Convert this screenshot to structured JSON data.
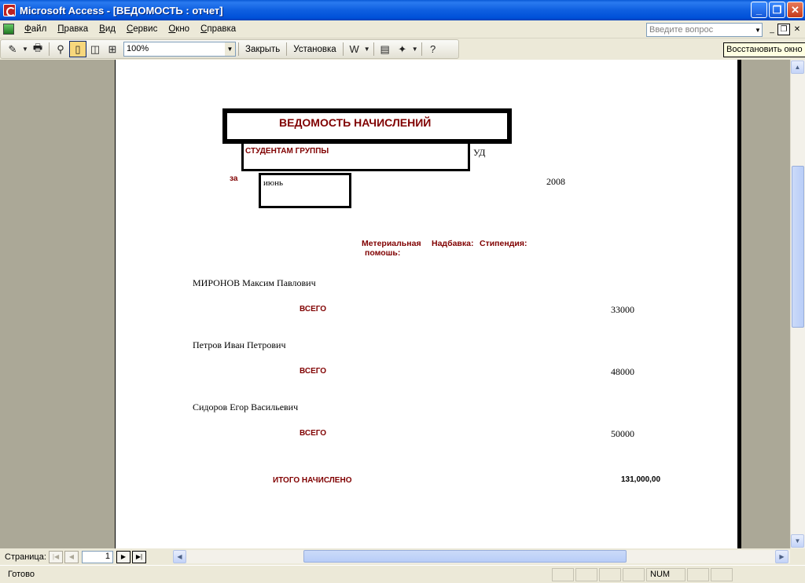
{
  "window": {
    "title": "Microsoft Access - [ВЕДОМОСТЬ : отчет]"
  },
  "menu": {
    "items": [
      "Файл",
      "Правка",
      "Вид",
      "Сервис",
      "Окно",
      "Справка"
    ],
    "ask_placeholder": "Введите вопрос"
  },
  "toolbar": {
    "zoom": "100%",
    "close_label": "Закрыть",
    "setup_label": "Установка",
    "restore_tooltip": "Восстановить окно"
  },
  "report": {
    "title": "ВЕДОМОСТЬ НАЧИСЛЕНИЙ",
    "group_label": "СТУДЕНТАМ ГРУППЫ",
    "group_value": "УД",
    "period_label": "за",
    "month": "июнь",
    "year": "2008",
    "columns": {
      "material_help_line1": "Метериальная",
      "material_help_line2": "помошь:",
      "bonus": "Надбавка:",
      "stipend": "Стипендия:"
    },
    "students": [
      {
        "name": "МИРОНОВ Максим Павлович",
        "total_label": "ВСЕГО",
        "total": "33000"
      },
      {
        "name": "Петров Иван Петрович",
        "total_label": "ВСЕГО",
        "total": "48000"
      },
      {
        "name": "Сидоров Егор Васильевич",
        "total_label": "ВСЕГО",
        "total": "50000"
      }
    ],
    "grand_total_label": "ИТОГО НАЧИСЛЕНО",
    "grand_total": "131,000,00"
  },
  "navigation": {
    "page_label": "Страница:",
    "page_number": "1"
  },
  "status": {
    "text": "Готово",
    "num": "NUM"
  }
}
